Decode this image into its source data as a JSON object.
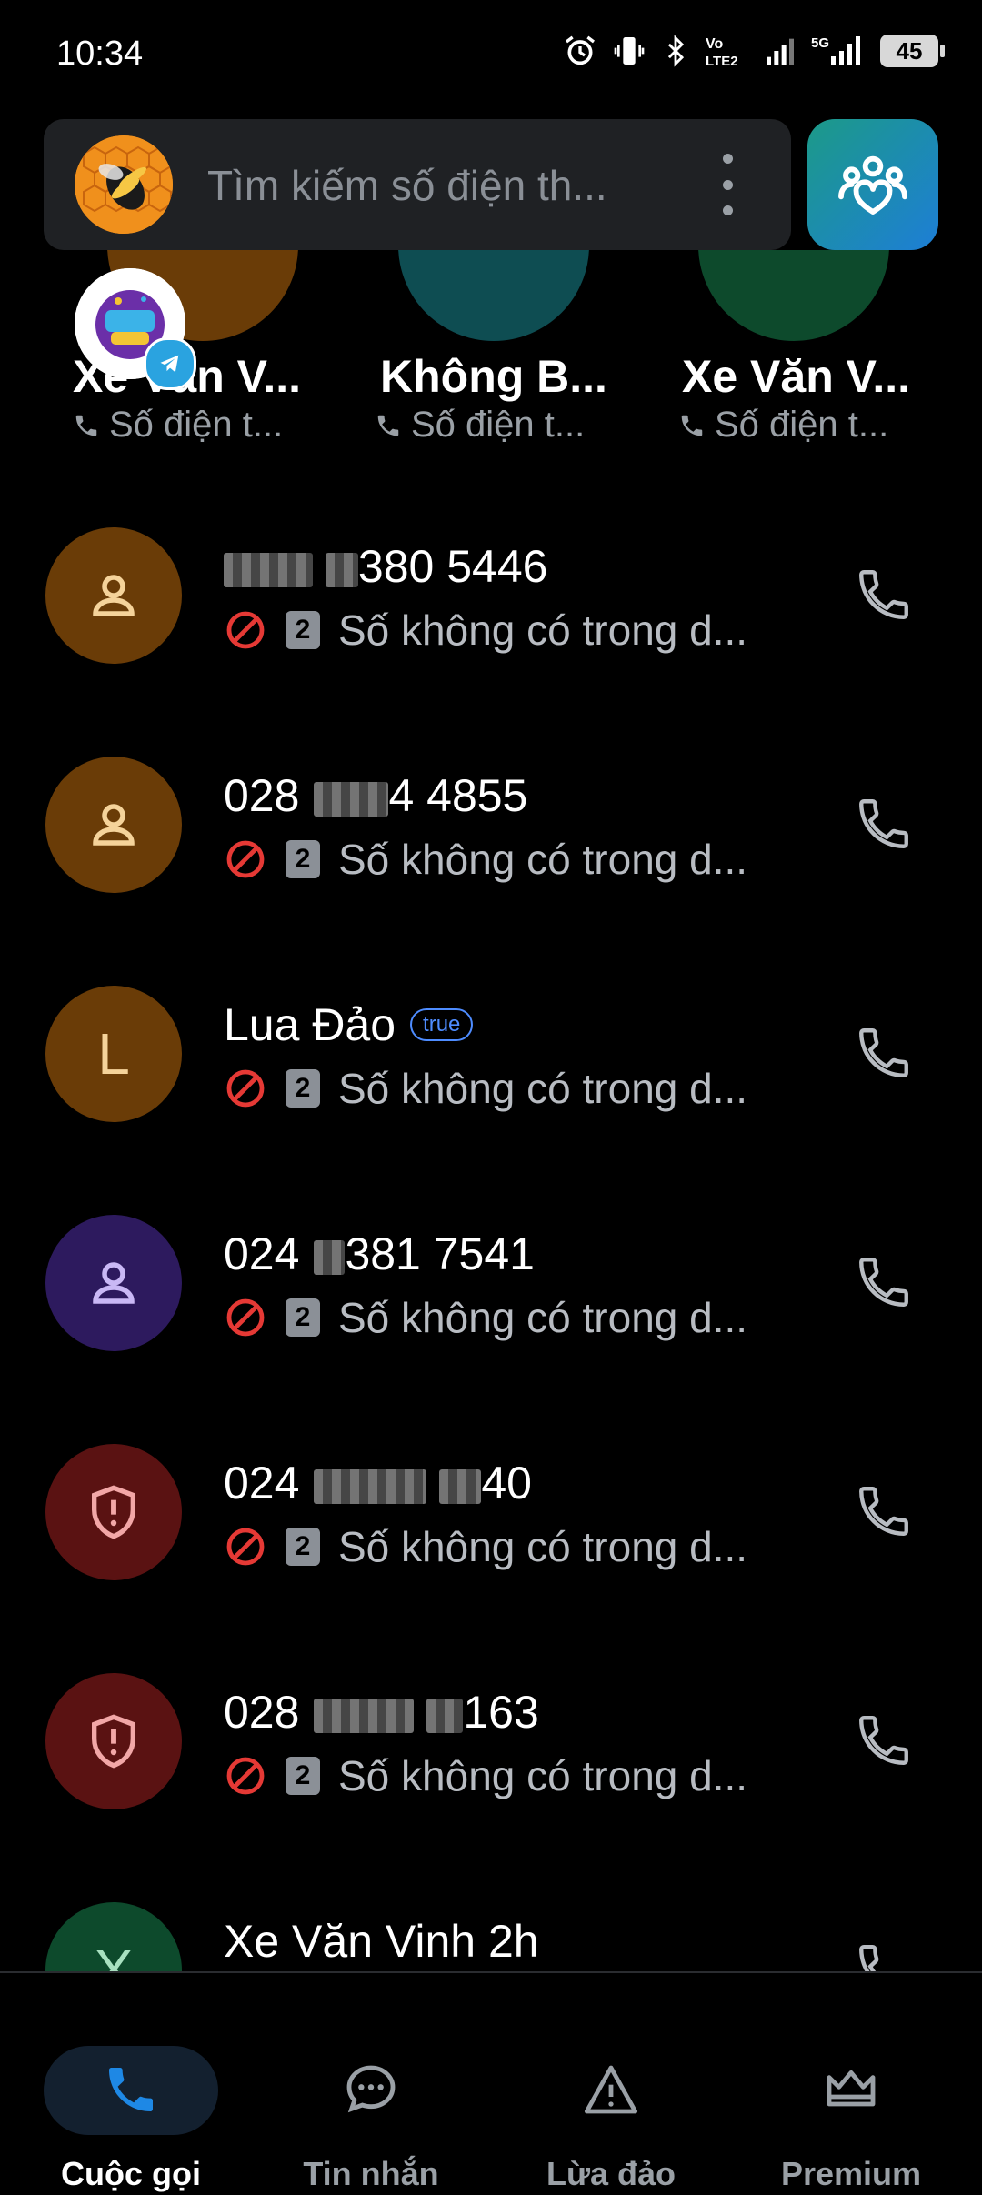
{
  "status_bar": {
    "time": "10:34",
    "battery_level": "45",
    "network_labels": [
      "Vo",
      "LTE2",
      "5G"
    ]
  },
  "header": {
    "search_placeholder": "Tìm kiếm số điện th..."
  },
  "favorites": [
    {
      "name": "Xe Văn V...",
      "subtitle": "Số điện t...",
      "color": "#6a3c07"
    },
    {
      "name": "Không B...",
      "subtitle": "Số điện t...",
      "color": "#0e4d52"
    },
    {
      "name": "Xe Văn V...",
      "subtitle": "Số điện t...",
      "color": "#0d4a2c"
    }
  ],
  "calls": [
    {
      "title_suffix": "380 5446",
      "subtitle": "Số không có trong d...",
      "avatar_type": "person",
      "avatar_color": "#6a3c07",
      "icon_color": "#f5d39a",
      "sim": "2"
    },
    {
      "title_prefix": "028",
      "title_suffix": "4 4855",
      "subtitle": "Số không có trong d...",
      "avatar_type": "person",
      "avatar_color": "#6a3c07",
      "icon_color": "#f5d39a",
      "sim": "2"
    },
    {
      "title": "Lua Đảo",
      "badge": "true",
      "subtitle": "Số không có trong d...",
      "avatar_type": "letter",
      "avatar_letter": "L",
      "avatar_color": "#6a3c07",
      "icon_color": "#f5d39a",
      "sim": "2"
    },
    {
      "title_prefix": "024",
      "title_suffix": "381 7541",
      "subtitle": "Số không có trong d...",
      "avatar_type": "person",
      "avatar_color": "#2d1a5e",
      "icon_color": "#c9b8f5",
      "sim": "2"
    },
    {
      "title_prefix": "024",
      "title_suffix": "40",
      "subtitle": "Số không có trong d...",
      "avatar_type": "shield",
      "avatar_color": "#5a1212",
      "icon_color": "#f2a7a7",
      "sim": "2"
    },
    {
      "title_prefix": "028",
      "title_suffix": "163",
      "subtitle": "Số không có trong d...",
      "avatar_type": "shield",
      "avatar_color": "#5a1212",
      "icon_color": "#f2a7a7",
      "sim": "2"
    },
    {
      "title": "Xe Văn Vinh 2h",
      "avatar_type": "letter",
      "avatar_letter": "X",
      "avatar_color": "#0d4a2c",
      "icon_color": "#a8e0c0"
    }
  ],
  "nav": {
    "calls": "Cuộc gọi",
    "messages": "Tin nhắn",
    "scam": "Lừa đảo",
    "premium": "Premium"
  },
  "colors": {
    "accent": "#1d7ed6",
    "blocked": "#e53935"
  }
}
